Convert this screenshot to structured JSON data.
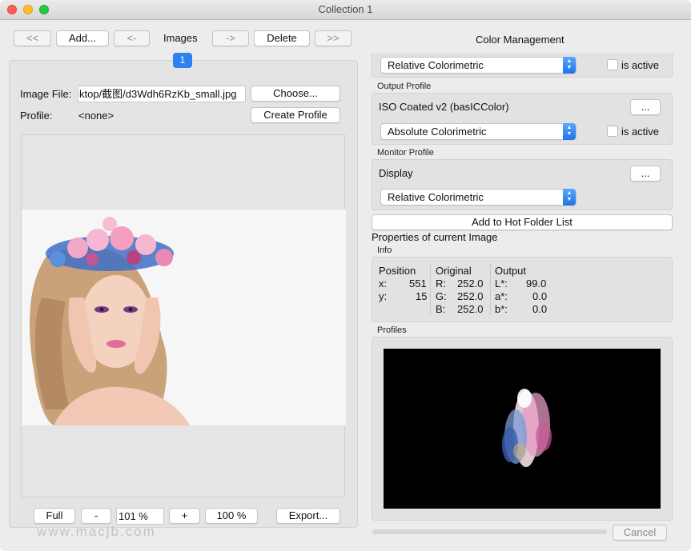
{
  "window": {
    "title": "Collection 1"
  },
  "nav": {
    "first": "<<",
    "add": "Add...",
    "prev": "<-",
    "images_label": "Images",
    "next": "->",
    "delete": "Delete",
    "last": ">>",
    "page_badge": "1"
  },
  "image_panel": {
    "image_file_label": "Image File:",
    "image_file_value": "ktop/截图/d3Wdh6RzKb_small.jpg",
    "choose": "Choose...",
    "profile_label": "Profile:",
    "profile_value": "<none>",
    "create_profile": "Create Profile"
  },
  "zoom": {
    "full": "Full",
    "minus": "-",
    "value": "101 %",
    "plus": "+",
    "hundred": "100 %",
    "export": "Export..."
  },
  "color_management": {
    "title": "Color Management",
    "input_intent": "Relative Colorimetric",
    "is_active_label": "is active",
    "output_profile_heading": "Output Profile",
    "output_profile_name": "ISO Coated v2 (basICColor)",
    "ellipsis": "...",
    "output_intent": "Absolute Colorimetric",
    "monitor_profile_heading": "Monitor Profile",
    "monitor_profile_name": "Display",
    "monitor_intent": "Relative Colorimetric",
    "add_hot_folder": "Add to Hot Folder List",
    "properties_heading": "Properties of current Image",
    "info_heading": "Info",
    "profiles_heading": "Profiles",
    "cancel": "Cancel"
  },
  "info": {
    "position_header": "Position",
    "x_label": "x:",
    "x_value": "551",
    "y_label": "y:",
    "y_value": "15",
    "original_header": "Original",
    "r_label": "R:",
    "r_value": "252.0",
    "g_label": "G:",
    "g_value": "252.0",
    "b_label": "B:",
    "b_value": "252.0",
    "output_header": "Output",
    "l_label": "L*:",
    "l_value": "99.0",
    "a_label": "a*:",
    "a_value": "0.0",
    "bb_label": "b*:",
    "bb_value": "0.0"
  },
  "watermark": {
    "text": "www.macjb.com"
  },
  "colors": {
    "accent": "#1f73e8",
    "close": "#fe5f57",
    "minimize": "#febc2e",
    "zoom": "#28c840"
  }
}
